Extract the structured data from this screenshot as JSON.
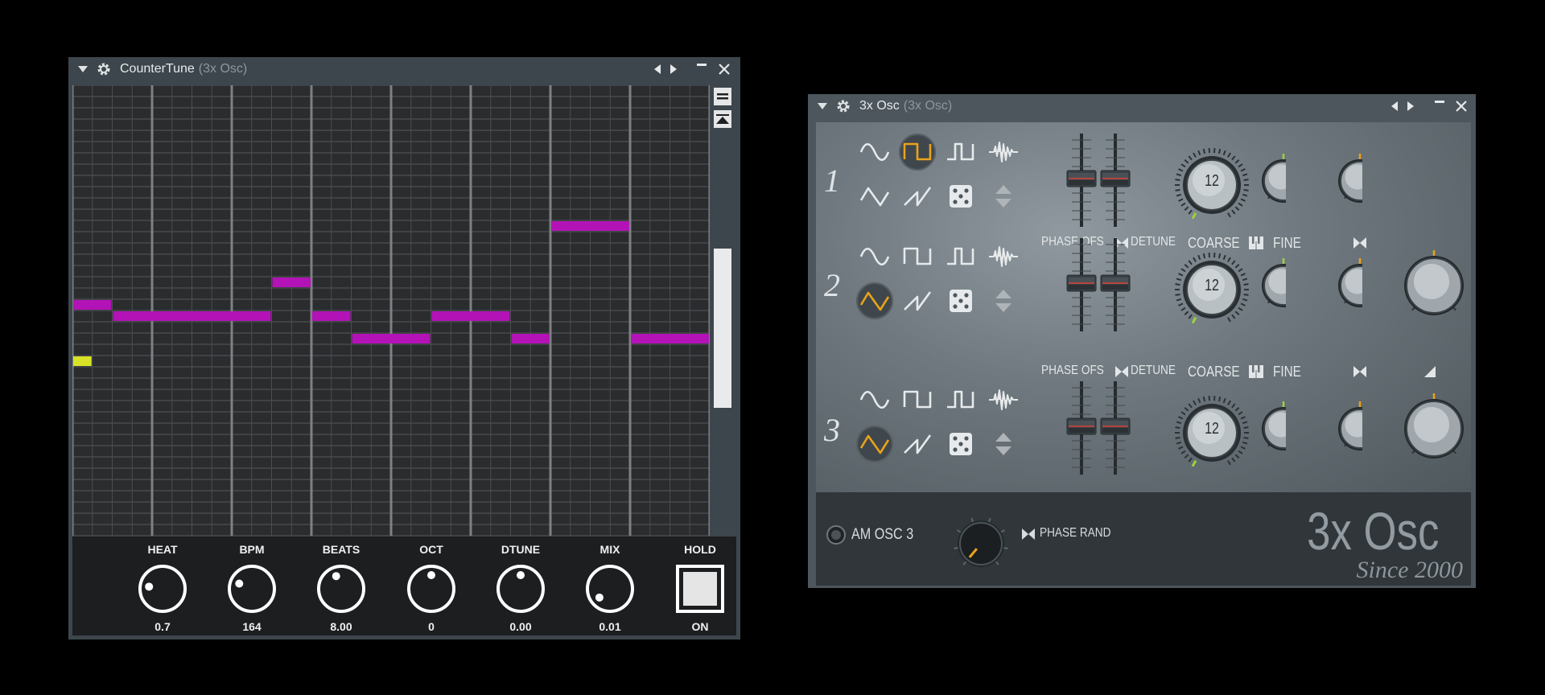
{
  "counter_tune": {
    "title": "CounterTune",
    "subtitle": "(3x Osc)",
    "notes": [
      {
        "row": 19,
        "start": 0,
        "length": 2,
        "color": "#b313b6"
      },
      {
        "row": 20,
        "start": 2,
        "length": 8,
        "color": "#b313b6"
      },
      {
        "row": 17,
        "start": 10,
        "length": 2,
        "color": "#b313b6"
      },
      {
        "row": 20,
        "start": 12,
        "length": 2,
        "color": "#b313b6"
      },
      {
        "row": 22,
        "start": 14,
        "length": 4,
        "color": "#b313b6"
      },
      {
        "row": 20,
        "start": 18,
        "length": 4,
        "color": "#b313b6"
      },
      {
        "row": 22,
        "start": 22,
        "length": 2,
        "color": "#b313b6"
      },
      {
        "row": 12,
        "start": 24,
        "length": 4,
        "color": "#b313b6"
      },
      {
        "row": 22,
        "start": 28,
        "length": 4,
        "color": "#b313b6"
      },
      {
        "row": 24,
        "start": 0,
        "length": 1,
        "color": "#d8e327"
      }
    ],
    "scroll_position": 0.42,
    "knobs": [
      {
        "label": "HEAT",
        "value": "0.7",
        "level": 0.2
      },
      {
        "label": "BPM",
        "value": "164",
        "level": 0.25
      },
      {
        "label": "BEATS",
        "value": "8.00",
        "level": 0.42
      },
      {
        "label": "OCT",
        "value": "0",
        "level": 0.5
      },
      {
        "label": "DTUNE",
        "value": "0.00",
        "level": 0.5
      },
      {
        "label": "MIX",
        "value": "0.01",
        "level": 0.02
      }
    ],
    "hold": {
      "label": "HOLD",
      "value": "ON"
    }
  },
  "osc": {
    "title": "3x Osc",
    "subtitle": "(3x Osc)",
    "oscillators": [
      {
        "number": "1",
        "selected_wave": "square",
        "coarse": "12",
        "has_pan": false
      },
      {
        "number": "2",
        "selected_wave": "triangle",
        "coarse": "12",
        "has_pan": true
      },
      {
        "number": "3",
        "selected_wave": "triangle",
        "coarse": "12",
        "has_pan": true
      }
    ],
    "labels": {
      "phase_ofs": "PHASE OFS",
      "detune": "DETUNE",
      "coarse": "COARSE",
      "fine": "FINE"
    },
    "am_label": "AM OSC 3",
    "phase_rand_label": "PHASE RAND",
    "brand": "3x Osc",
    "since": "Since 2000",
    "colors": {
      "accent": "#e9a21a",
      "led": "#9bd43a",
      "panel": "#30363a"
    }
  }
}
